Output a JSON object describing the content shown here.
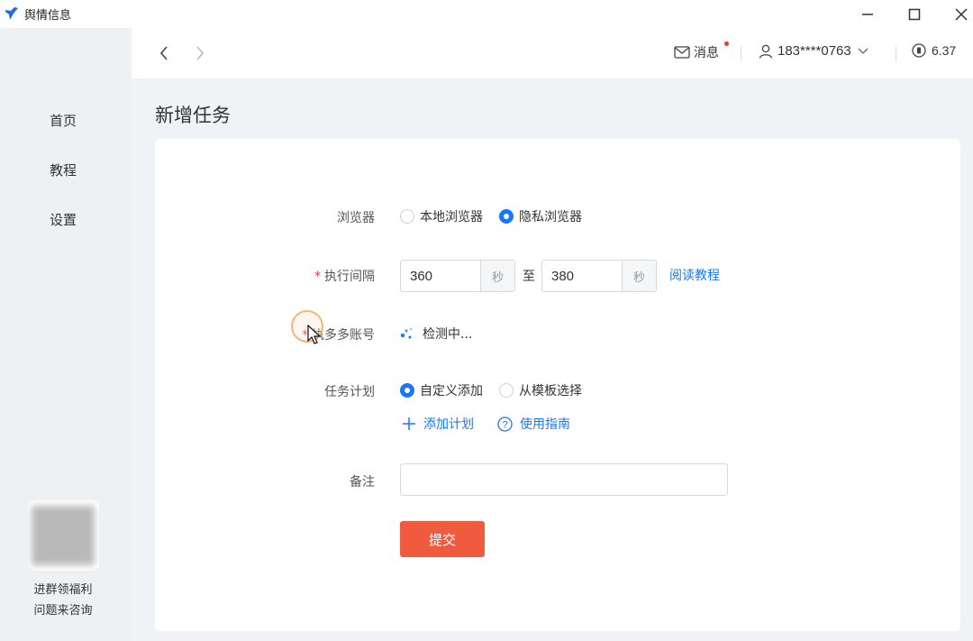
{
  "window": {
    "title": "舆情信息"
  },
  "sidebar": {
    "items": [
      {
        "label": "首页"
      },
      {
        "label": "教程"
      },
      {
        "label": "设置"
      }
    ],
    "promo_lines": [
      "进群领福利",
      "问题来咨询"
    ]
  },
  "header": {
    "messages_label": "消息",
    "user_phone": "183****0763",
    "balance": "6.37"
  },
  "page": {
    "title": "新增任务"
  },
  "form": {
    "browser": {
      "label": "浏览器",
      "options": [
        "本地浏览器",
        "隐私浏览器"
      ],
      "selected": "隐私浏览器"
    },
    "interval": {
      "label": "执行间隔",
      "required": true,
      "from_value": "360",
      "to_value": "380",
      "unit": "秒",
      "separator": "至",
      "tutorial_link": "阅读教程"
    },
    "accounts": {
      "label": "执多多账号",
      "required": true,
      "status": "检测中..."
    },
    "plan": {
      "label": "任务计划",
      "options": [
        "自定义添加",
        "从模板选择"
      ],
      "selected": "自定义添加",
      "add_link": "添加计划",
      "guide_link": "使用指南"
    },
    "note": {
      "label": "备注",
      "value": ""
    },
    "submit_label": "提交"
  },
  "colors": {
    "accent": "#1677ff",
    "submit": "#f05a3f",
    "required": "#e4393c",
    "sidebar_bg": "#eef1f4"
  }
}
